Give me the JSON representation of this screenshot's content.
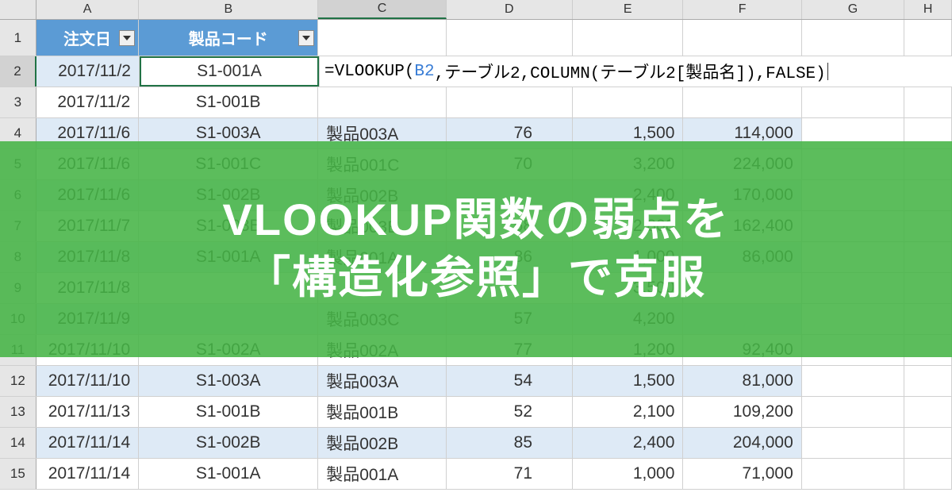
{
  "colHeaders": [
    "A",
    "B",
    "C",
    "D",
    "E",
    "F",
    "G",
    "H"
  ],
  "colWidths": {
    "A": 130,
    "B": 227,
    "C": 162,
    "D": 160,
    "E": 140,
    "F": 150,
    "G": 130,
    "H": 60
  },
  "selectedColHdr": "C",
  "selectedRowHdr": "2",
  "selectedCell": "B2",
  "tableHeaders": {
    "A": "注文日",
    "B": "製品コード"
  },
  "formula": {
    "eq": "=",
    "fn1": "VLOOKUP",
    "p_open": "(",
    "ref": "B2",
    "seg2": ",テーブル2,",
    "fn2": "COLUMN",
    "p_open2": "(",
    "seg3": "テーブル2[製品名]",
    "p_close2": ")",
    "seg4": ",FALSE",
    "p_close": ")"
  },
  "rows": [
    {
      "n": "2",
      "band": "a",
      "A": "2017/11/2",
      "B": "S1-001A",
      "formula": true
    },
    {
      "n": "3",
      "band": "b",
      "A": "2017/11/2",
      "B": "S1-001B"
    },
    {
      "n": "4",
      "band": "a",
      "A": "2017/11/6",
      "B": "S1-003A",
      "C": "製品003A",
      "D": "76",
      "E": "1,500",
      "F": "114,000"
    },
    {
      "n": "5",
      "band": "b",
      "A": "2017/11/6",
      "B": "S1-001C",
      "C": "製品001C",
      "D": "70",
      "E": "3,200",
      "F": "224,000"
    },
    {
      "n": "6",
      "band": "a",
      "A": "2017/11/6",
      "B": "S1-002B",
      "C": "製品002B",
      "D": "",
      "E": "2,400",
      "F": "170,000"
    },
    {
      "n": "7",
      "band": "b",
      "A": "2017/11/7",
      "B": "S1-003B",
      "C": "製品003B",
      "D": "58",
      "E": "2,800",
      "F": "162,400"
    },
    {
      "n": "8",
      "band": "a",
      "A": "2017/11/8",
      "B": "S1-001A",
      "C": "製品001A",
      "D": "86",
      "E": "1,000",
      "F": "86,000"
    },
    {
      "n": "9",
      "band": "b",
      "A": "2017/11/8",
      "B": "",
      "C": "",
      "D": "",
      "E": "3,500",
      "F": "",
      "hidden": true
    },
    {
      "n": "10",
      "band": "a",
      "A": "2017/11/9",
      "B": "",
      "C": "製品003C",
      "D": "57",
      "E": "4,200",
      "F": "",
      "hidden": true
    },
    {
      "n": "11",
      "band": "b",
      "A": "2017/11/10",
      "B": "S1-002A",
      "C": "製品002A",
      "D": "77",
      "E": "1,200",
      "F": "92,400"
    },
    {
      "n": "12",
      "band": "a",
      "A": "2017/11/10",
      "B": "S1-003A",
      "C": "製品003A",
      "D": "54",
      "E": "1,500",
      "F": "81,000"
    },
    {
      "n": "13",
      "band": "b",
      "A": "2017/11/13",
      "B": "S1-001B",
      "C": "製品001B",
      "D": "52",
      "E": "2,100",
      "F": "109,200"
    },
    {
      "n": "14",
      "band": "a",
      "A": "2017/11/14",
      "B": "S1-002B",
      "C": "製品002B",
      "D": "85",
      "E": "2,400",
      "F": "204,000"
    },
    {
      "n": "15",
      "band": "b",
      "A": "2017/11/14",
      "B": "S1-001A",
      "C": "製品001A",
      "D": "71",
      "E": "1,000",
      "F": "71,000"
    }
  ],
  "overlay": {
    "line1": "VLOOKUP関数の弱点を",
    "line2": "「構造化参照」で克服"
  }
}
